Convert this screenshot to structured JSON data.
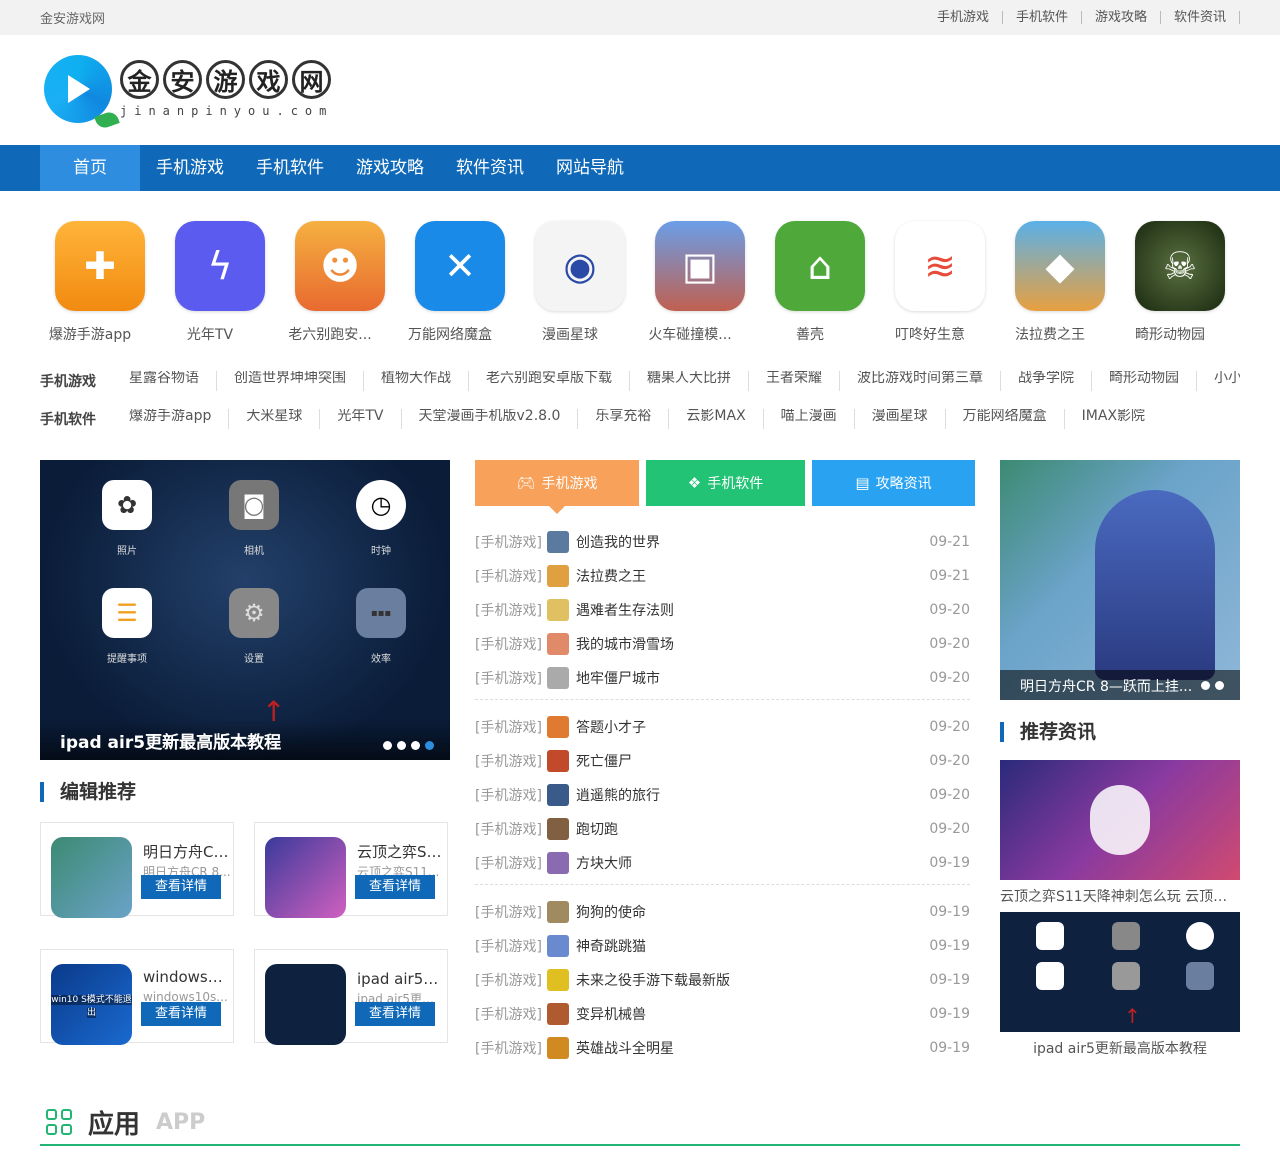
{
  "topbar": {
    "site": "金安游戏网",
    "links": [
      "手机游戏",
      "手机软件",
      "游戏攻略",
      "软件资讯"
    ]
  },
  "logo": {
    "chars": [
      "金",
      "安",
      "游",
      "戏",
      "网"
    ],
    "sub": "jinanpinyou.com"
  },
  "nav": [
    "首页",
    "手机游戏",
    "手机软件",
    "游戏攻略",
    "软件资讯",
    "网站导航"
  ],
  "apps": [
    {
      "name": "爆游手游app",
      "icon": "gamepad-icon",
      "color": "#f7a020"
    },
    {
      "name": "光年TV",
      "icon": "lightning-icon",
      "color": "#5b5bf0"
    },
    {
      "name": "老六别跑安...",
      "icon": "game-icon",
      "color": "#f08a30"
    },
    {
      "name": "万能网络魔盒",
      "icon": "wifi-icon",
      "color": "#1a8ae8"
    },
    {
      "name": "漫画星球",
      "icon": "planet-icon",
      "color": "#f4f4f4"
    },
    {
      "name": "火车碰撞模...",
      "icon": "train-icon",
      "color": "#6a9ee8"
    },
    {
      "name": "善壳",
      "icon": "house-icon",
      "color": "#4fa83a"
    },
    {
      "name": "叮咚好生意",
      "icon": "layers-icon",
      "color": "#ffffff"
    },
    {
      "name": "法拉费之王",
      "icon": "food-icon",
      "color": "#f0b040"
    },
    {
      "name": "畸形动物园",
      "icon": "zoo-icon",
      "color": "#2a3a20"
    }
  ],
  "tags_games": {
    "label": "手机游戏",
    "items": [
      "星露谷物语",
      "创造世界坤坤突围",
      "植物大作战",
      "老六别跑安卓版下载",
      "糖果人大比拼",
      "王者荣耀",
      "波比游戏时间第三章",
      "战争学院",
      "畸形动物园",
      "小小"
    ]
  },
  "tags_software": {
    "label": "手机软件",
    "items": [
      "爆游手游app",
      "大米星球",
      "光年TV",
      "天堂漫画手机版v2.8.0",
      "乐享充裕",
      "云影MAX",
      "喵上漫画",
      "漫画星球",
      "万能网络魔盒",
      "IMAX影院"
    ]
  },
  "banner": {
    "caption": "ipad air5更新最高版本教程",
    "icons": [
      "照片",
      "相机",
      "时钟",
      "提醒事项",
      "设置",
      "效率"
    ]
  },
  "editor": {
    "title": "编辑推荐",
    "button": "查看详情",
    "items": [
      {
        "t1": "明日方舟CR...",
        "t2": "明日方舟CR 8..."
      },
      {
        "t1": "云顶之弈S1...",
        "t2": "云顶之弈S11..."
      },
      {
        "t1": "windows10...",
        "t2": "windows10s..."
      },
      {
        "t1": "ipad air5更...",
        "t2": "ipad air5更新..."
      }
    ],
    "win_thumb_text": "win10 S模式不能退出"
  },
  "tabs": [
    "手机游戏",
    "手机软件",
    "攻略资讯"
  ],
  "news_groups": [
    [
      {
        "cat": "[手机游戏]",
        "title": "创造我的世界",
        "date": "09-21"
      },
      {
        "cat": "[手机游戏]",
        "title": "法拉费之王",
        "date": "09-21"
      },
      {
        "cat": "[手机游戏]",
        "title": "遇难者生存法则",
        "date": "09-20"
      },
      {
        "cat": "[手机游戏]",
        "title": "我的城市滑雪场",
        "date": "09-20"
      },
      {
        "cat": "[手机游戏]",
        "title": "地牢僵尸城市",
        "date": "09-20"
      }
    ],
    [
      {
        "cat": "[手机游戏]",
        "title": "答题小才子",
        "date": "09-20"
      },
      {
        "cat": "[手机游戏]",
        "title": "死亡僵尸",
        "date": "09-20"
      },
      {
        "cat": "[手机游戏]",
        "title": "逍遥熊的旅行",
        "date": "09-20"
      },
      {
        "cat": "[手机游戏]",
        "title": "跑切跑",
        "date": "09-20"
      },
      {
        "cat": "[手机游戏]",
        "title": "方块大师",
        "date": "09-19"
      }
    ],
    [
      {
        "cat": "[手机游戏]",
        "title": "狗狗的使命",
        "date": "09-19"
      },
      {
        "cat": "[手机游戏]",
        "title": "神奇跳跳猫",
        "date": "09-19"
      },
      {
        "cat": "[手机游戏]",
        "title": "未来之役手游下载最新版",
        "date": "09-19"
      },
      {
        "cat": "[手机游戏]",
        "title": "变异机械兽",
        "date": "09-19"
      },
      {
        "cat": "[手机游戏]",
        "title": "英雄战斗全明星",
        "date": "09-19"
      }
    ]
  ],
  "right": {
    "banner_caption": "明日方舟CR 8—跃而上挂...",
    "title": "推荐资讯",
    "articles": [
      {
        "caption": "云顶之弈S11天降神刺怎么玩 云顶之..."
      },
      {
        "caption": "ipad air5更新最高版本教程"
      }
    ]
  },
  "bottom": {
    "title": "应用",
    "sub": "APP"
  },
  "colors": {
    "nav": "#0f69b8",
    "tab_orange": "#f7a15a",
    "tab_green": "#22c374",
    "tab_blue": "#29a3f1",
    "accent_green": "#22b573"
  }
}
